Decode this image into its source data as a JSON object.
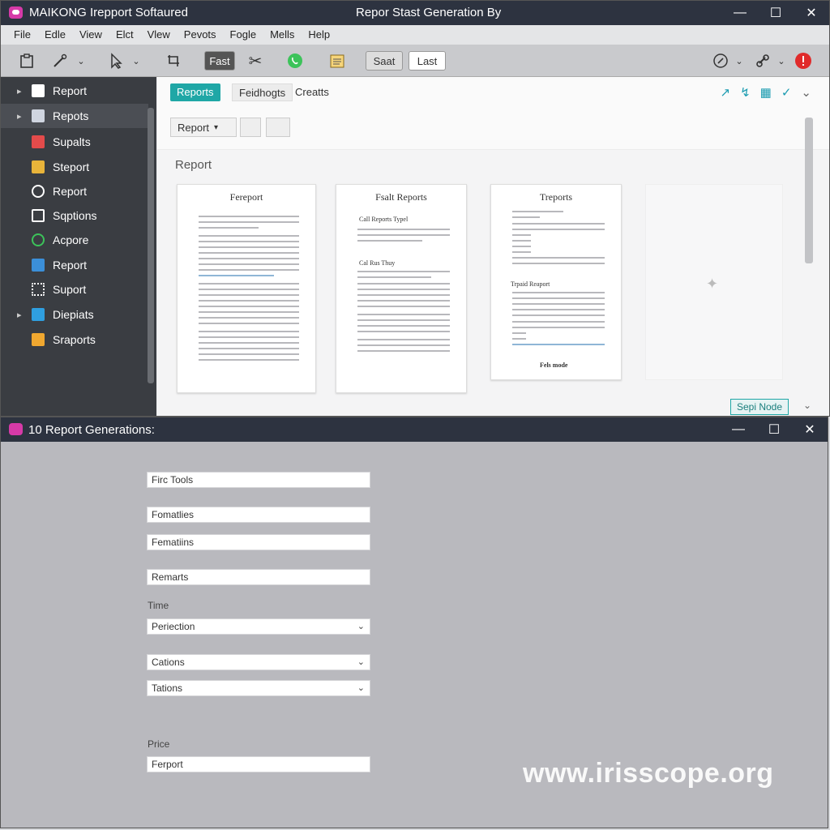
{
  "window1": {
    "app_title": "MAIKONG Irepport Softaured",
    "doc_title": "Repor Stast Generation By",
    "controls": {
      "minimize": "—",
      "maximize": "☐",
      "close": "✕"
    }
  },
  "menu": [
    "File",
    "Edle",
    "View",
    "Elct",
    "Vlew",
    "Pevots",
    "Fogle",
    "Mells",
    "Help"
  ],
  "toolbar": {
    "fast_label": "Fast",
    "start_label": "Saat",
    "last_label": "Last"
  },
  "sidebar": {
    "items": [
      {
        "label": "Report",
        "icon_color": "#ffffff"
      },
      {
        "label": "Repots",
        "icon_color": "#cfd5e0"
      },
      {
        "label": "Supalts",
        "icon_color": "#e34b4b"
      },
      {
        "label": "Steport",
        "icon_color": "#e8b43a"
      },
      {
        "label": "Report",
        "icon_color": "#ffffff"
      },
      {
        "label": "Sqptions",
        "icon_color": "#ffffff"
      },
      {
        "label": "Acpore",
        "icon_color": "#3cc35a"
      },
      {
        "label": "Report",
        "icon_color": "#3b8fd9"
      },
      {
        "label": "Suport",
        "icon_color": "#ffffff"
      },
      {
        "label": "Diepiats",
        "icon_color": "#2f9fe0"
      },
      {
        "label": "Sraports",
        "icon_color": "#f0a830"
      }
    ]
  },
  "tabs": [
    "Reports",
    "Feidhogts",
    "Creatts"
  ],
  "subtoolbar": {
    "report_select": "Report"
  },
  "section_title": "Report",
  "pages": [
    {
      "title": "Fereport",
      "sub1": "",
      "sub2": ""
    },
    {
      "title": "Fsalt Reports",
      "sub1": "Call Reports Typel",
      "sub2": "Cal Rus Thuy"
    },
    {
      "title": "Treports",
      "sub1": "Trpaid Reaport",
      "sub2": "Fels mode"
    }
  ],
  "save_button": "Sepi Node",
  "window2": {
    "title": "10 Report Generations:",
    "fields": [
      {
        "value": "Firc Tools"
      },
      {
        "value": "Fomatlies"
      },
      {
        "value": "Fematiins"
      },
      {
        "value": "Remarts"
      }
    ],
    "label_time": "Time",
    "selects": [
      {
        "value": "Periection"
      },
      {
        "value": "Cations"
      },
      {
        "value": "Tations"
      }
    ],
    "label_price": "Price",
    "last_field": "Ferport"
  },
  "watermark": "www.irisscope.org"
}
